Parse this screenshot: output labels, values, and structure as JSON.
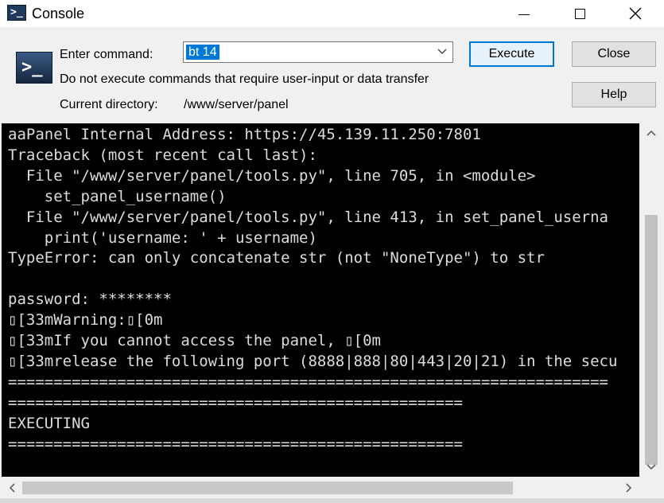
{
  "window": {
    "title": "Console",
    "icon": "console-icon"
  },
  "form": {
    "command_label": "Enter command:",
    "command_value": "bt 14",
    "warning_text": "Do not execute commands that require user-input or data transfer",
    "directory_label": "Current directory:",
    "directory_value": "/www/server/panel"
  },
  "buttons": {
    "execute": "Execute",
    "close": "Close",
    "help": "Help"
  },
  "console": {
    "lines": [
      "aaPanel Internal Address: https://45.139.11.250:7801",
      "Traceback (most recent call last):",
      "  File \"/www/server/panel/tools.py\", line 705, in <module>",
      "    set_panel_username()",
      "  File \"/www/server/panel/tools.py\", line 413, in set_panel_userna",
      "    print('username: ' + username)",
      "TypeError: can only concatenate str (not \"NoneType\") to str",
      "",
      "password: ********",
      "▯[33mWarning:▯[0m",
      "▯[33mIf you cannot access the panel, ▯[0m",
      "▯[33mrelease the following port (8888|888|80|443|20|21) in the secu",
      "==================================================================",
      "==================================================",
      "EXECUTING",
      "=================================================="
    ]
  },
  "colors": {
    "console_bg": "#000000",
    "console_fg": "#dcdcdc",
    "selection": "#0078d7",
    "default_button_border": "#0078d7"
  }
}
